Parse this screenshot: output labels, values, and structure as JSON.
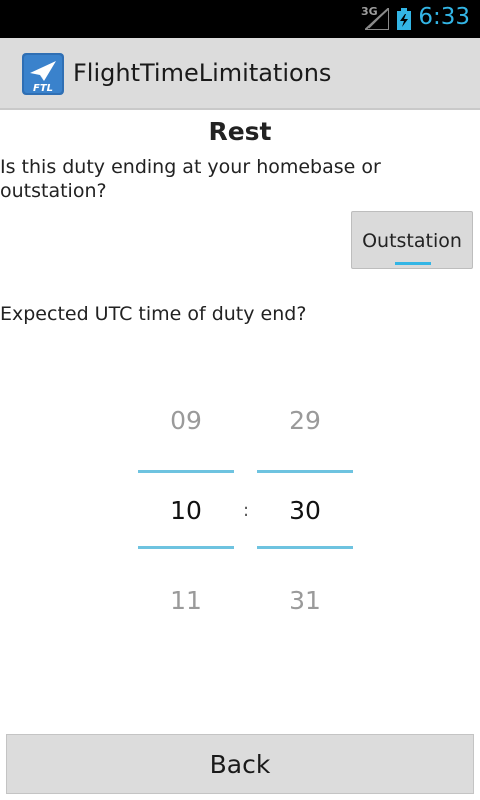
{
  "status_bar": {
    "network": "3G",
    "time": "6:33"
  },
  "action_bar": {
    "title": "FlightTimeLimitations",
    "icon_text": "FTL"
  },
  "content": {
    "heading": "Rest",
    "question_location": "Is this duty ending at your homebase or outstation?",
    "location_button": "Outstation",
    "question_time": "Expected UTC time of duty end?"
  },
  "time_picker": {
    "hours": {
      "prev": "09",
      "current": "10",
      "next": "11"
    },
    "separator": ":",
    "minutes": {
      "prev": "29",
      "current": "30",
      "next": "31"
    }
  },
  "back_button": "Back",
  "colors": {
    "accent": "#33b5e5",
    "action_bar": "#dcdcdc",
    "status_bar": "#000000"
  }
}
